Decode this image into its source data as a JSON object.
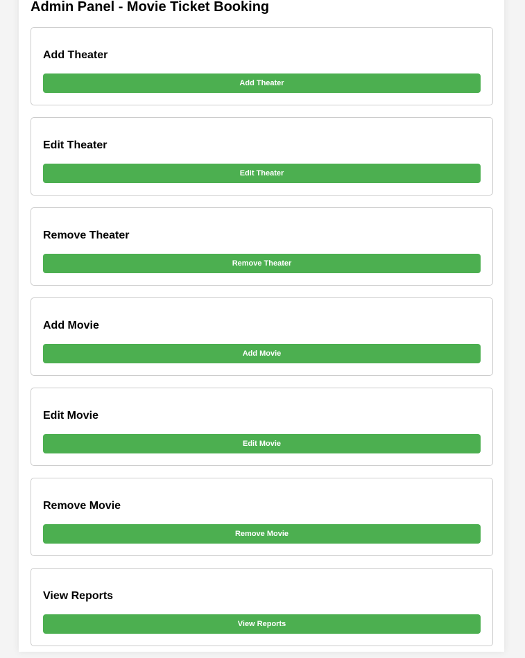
{
  "header": {
    "title": "Admin Panel - Movie Ticket Booking"
  },
  "sections": [
    {
      "title": "Add Theater",
      "button_label": "Add Theater"
    },
    {
      "title": "Edit Theater",
      "button_label": "Edit Theater"
    },
    {
      "title": "Remove Theater",
      "button_label": "Remove Theater"
    },
    {
      "title": "Add Movie",
      "button_label": "Add Movie"
    },
    {
      "title": "Edit Movie",
      "button_label": "Edit Movie"
    },
    {
      "title": "Remove Movie",
      "button_label": "Remove Movie"
    },
    {
      "title": "View Reports",
      "button_label": "View Reports"
    }
  ],
  "colors": {
    "button_background": "#4caf50",
    "button_text": "#ffffff",
    "page_background": "#f4f4f4",
    "card_border": "#cccccc"
  }
}
